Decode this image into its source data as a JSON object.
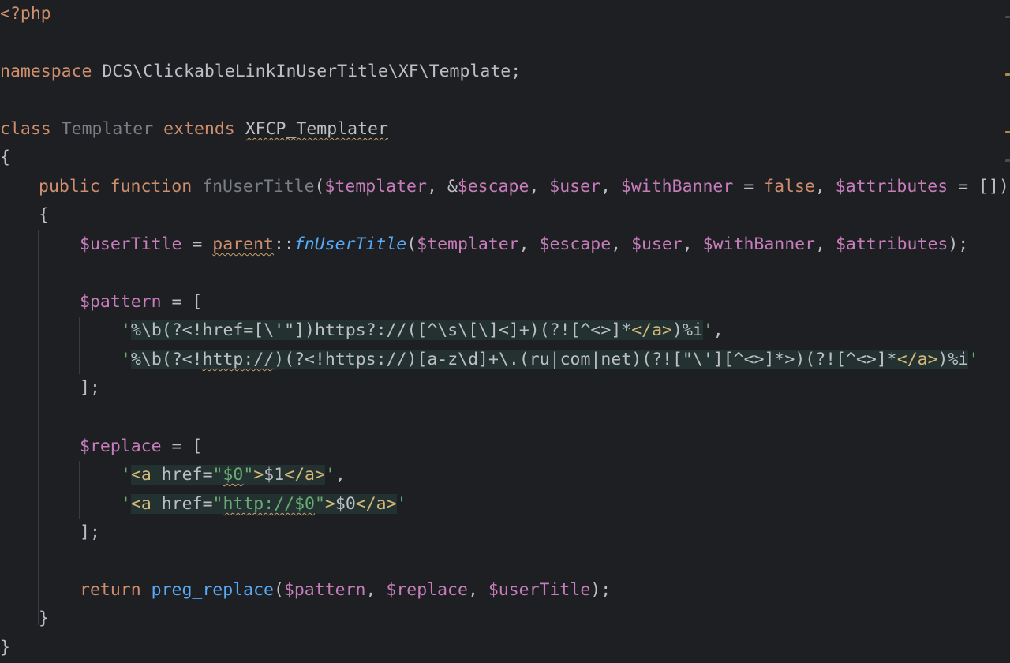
{
  "editor": {
    "lines": {
      "l1": "<?php",
      "l3_kw": "namespace",
      "l3_rest": " DCS\\ClickableLinkInUserTitle\\XF\\Template;",
      "l5_kw": "class",
      "l5_name": "Templater",
      "l5_ext": "extends",
      "l5_parent": "XFCP_Templater",
      "l6": "{",
      "l7_kw1": "public",
      "l7_kw2": "function",
      "l7_name": "fnUserTitle",
      "l7_p0": "(",
      "l7_v1": "$templater",
      "l7_p1": ", &",
      "l7_v2": "$escape",
      "l7_p2": ", ",
      "l7_v3": "$user",
      "l7_p3": ", ",
      "l7_v4": "$withBanner",
      "l7_p4": " = ",
      "l7_false": "false",
      "l7_p5": ", ",
      "l7_v5": "$attributes",
      "l7_p6": " = [])",
      "l8": "{",
      "l9_v1": "$userTitle",
      "l9_p1": " = ",
      "l9_parent": "parent",
      "l9_p2": "::",
      "l9_fn": "fnUserTitle",
      "l9_p3": "(",
      "l9_a1": "$templater",
      "l9_p4": ", ",
      "l9_a2": "$escape",
      "l9_p5": ", ",
      "l9_a3": "$user",
      "l9_p6": ", ",
      "l9_a4": "$withBanner",
      "l9_p7": ", ",
      "l9_a5": "$attributes",
      "l9_p8": ");",
      "l11_v": "$pattern",
      "l11_p": " = [",
      "l12_q1": "'",
      "l12_a": "%\\b(?<!href=[\\'\"])https?://([^\\s\\[\\]<]+)(?![^<>]*",
      "l12_tag": "</a>",
      "l12_b": ")%i",
      "l12_q2": "'",
      "l12_comma": ",",
      "l13_q1": "'",
      "l13_a": "%\\b(?<!",
      "l13_http": "http://",
      "l13_b": ")(?<!https://)[a-z\\d]+\\.(ru|com|net)(?![\"\\'][^<>]*>)(?![^<>]*",
      "l13_tag": "</a>",
      "l13_c": ")%i",
      "l13_q2": "'",
      "l14": "];",
      "l16_v": "$replace",
      "l16_p": " = [",
      "l17_q1": "'",
      "l17_t1": "<a",
      "l17_attr": " href=",
      "l17_val1": "\"",
      "l17_val2": "$0",
      "l17_val3": "\"",
      "l17_t2": ">",
      "l17_txt": "$1",
      "l17_t3": "</a>",
      "l17_q2": "'",
      "l17_comma": ",",
      "l18_q1": "'",
      "l18_t1": "<a",
      "l18_attr": " href=",
      "l18_val1": "\"",
      "l18_val2": "http://$0",
      "l18_val3": "\"",
      "l18_t2": ">",
      "l18_txt": "$0",
      "l18_t3": "</a>",
      "l18_q2": "'",
      "l19": "];",
      "l21_kw": "return",
      "l21_fn": "preg_replace",
      "l21_p1": "(",
      "l21_a1": "$pattern",
      "l21_p2": ", ",
      "l21_a2": "$replace",
      "l21_p3": ", ",
      "l21_a3": "$userTitle",
      "l21_p4": ");",
      "l22": "}",
      "l23": "}"
    }
  },
  "colors": {
    "background": "#1e1f22",
    "keyword": "#cf8e6d",
    "variable": "#c77dbb",
    "string": "#6aab73",
    "function": "#57aaf7",
    "html_tag": "#d5b778",
    "injection_bg": "#233131"
  }
}
